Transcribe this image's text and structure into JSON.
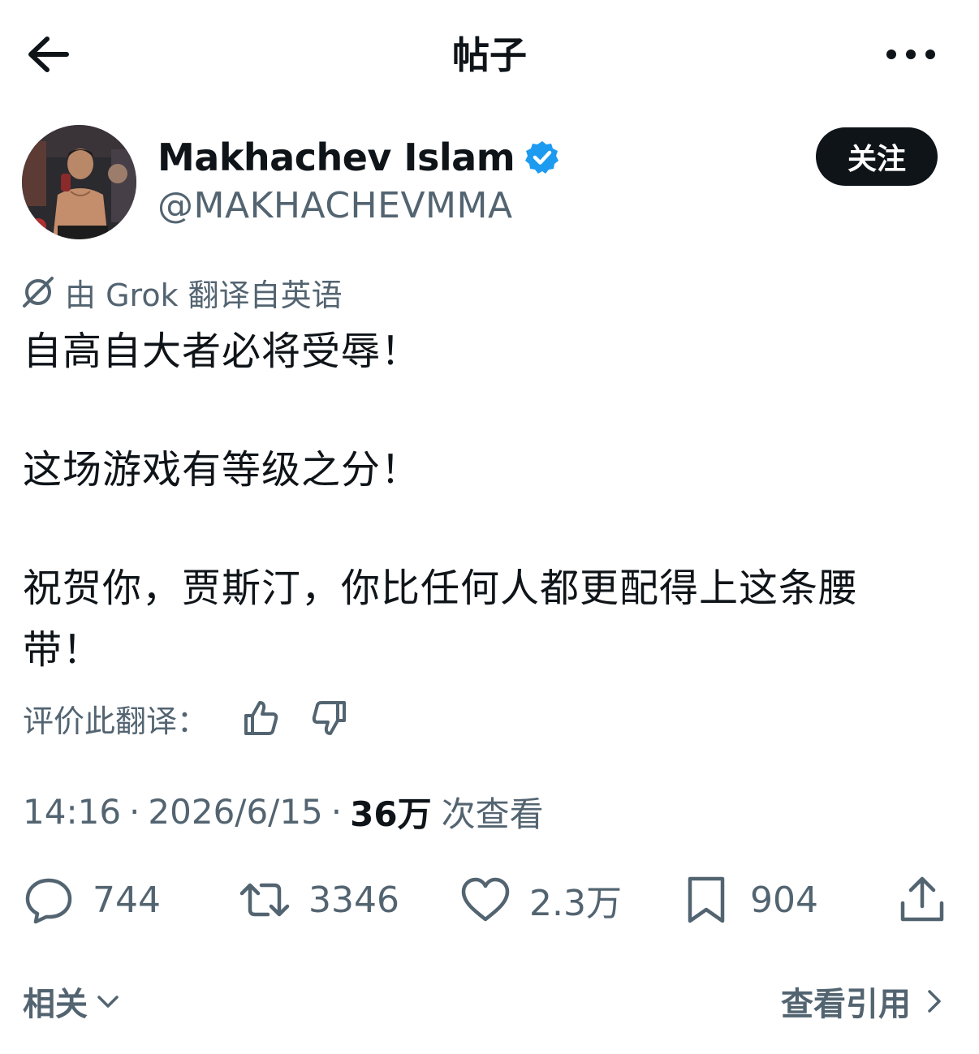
{
  "header": {
    "title": "帖子"
  },
  "author": {
    "name": "Makhachev Islam",
    "handle": "@MAKHACHEVMMA",
    "follow_label": "关注"
  },
  "translation": {
    "note": "由 Grok 翻译自英语",
    "rate_label": "评价此翻译："
  },
  "post": {
    "lines": [
      "自高自大者必将受辱！",
      "这场游戏有等级之分！",
      "祝贺你，贾斯汀，你比任何人都更配得上这条腰",
      "带！"
    ]
  },
  "meta": {
    "time": "14:16",
    "separator": "·",
    "date": "2026/6/15",
    "views_count": "36万",
    "views_label": "次查看"
  },
  "actions": {
    "replies": "744",
    "reposts": "3346",
    "likes": "2.3万",
    "bookmarks": "904"
  },
  "footer": {
    "related_label": "相关",
    "quotes_label": "查看引用"
  },
  "colors": {
    "text": "#0f1419",
    "secondary": "#536471",
    "verified": "#1d9bf0",
    "button": "#0f1419"
  }
}
